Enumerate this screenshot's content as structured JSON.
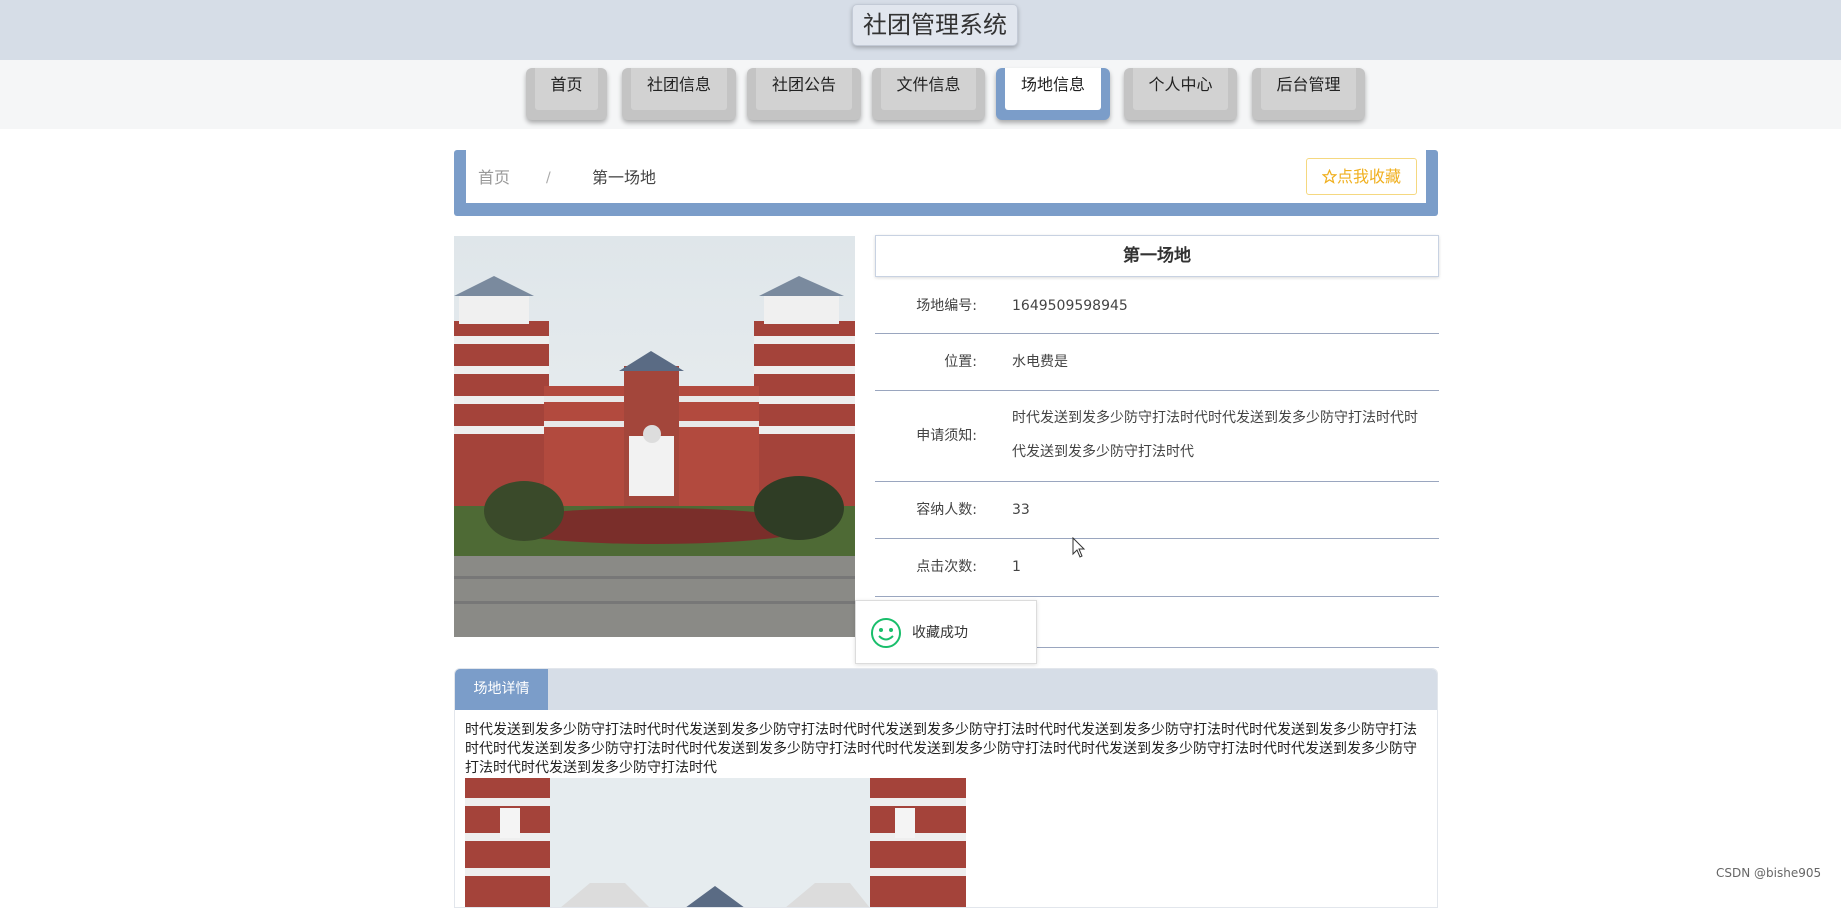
{
  "header": {
    "title": "社团管理系统"
  },
  "nav": {
    "items": [
      {
        "label": "首页"
      },
      {
        "label": "社团信息"
      },
      {
        "label": "社团公告"
      },
      {
        "label": "文件信息"
      },
      {
        "label": "场地信息"
      },
      {
        "label": "个人中心"
      },
      {
        "label": "后台管理"
      }
    ],
    "active_index": 4
  },
  "breadcrumb": {
    "home": "首页",
    "separator": "/",
    "current": "第一场地"
  },
  "favorite_button": {
    "label": "点我收藏",
    "icon": "star-outline-icon"
  },
  "venue": {
    "title": "第一场地",
    "fields": [
      {
        "label": "场地编号:",
        "value": "1649509598945"
      },
      {
        "label": "位置:",
        "value": "水电费是"
      },
      {
        "label": "申请须知:",
        "value": "时代发送到发多少防守打法时代时代发送到发多少防守打法时代时代发送到发多少防守打法时代"
      },
      {
        "label": "容纳人数:",
        "value": "33"
      },
      {
        "label": "点击次数:",
        "value": "1"
      }
    ]
  },
  "toast": {
    "message": "收藏成功",
    "icon": "smile-icon"
  },
  "detail": {
    "tab_label": "场地详情",
    "text": "时代发送到发多少防守打法时代时代发送到发多少防守打法时代时代发送到发多少防守打法时代时代发送到发多少防守打法时代时代发送到发多少防守打法时代时代发送到发多少防守打法时代时代发送到发多少防守打法时代时代发送到发多少防守打法时代时代发送到发多少防守打法时代时代发送到发多少防守打法时代时代发送到发多少防守打法时代"
  },
  "watermark": "CSDN @bishe905",
  "colors": {
    "accent": "#7b9dc9",
    "header_bg": "#d6dde7",
    "favorite": "#f0b020",
    "toast_icon": "#19be6b"
  }
}
